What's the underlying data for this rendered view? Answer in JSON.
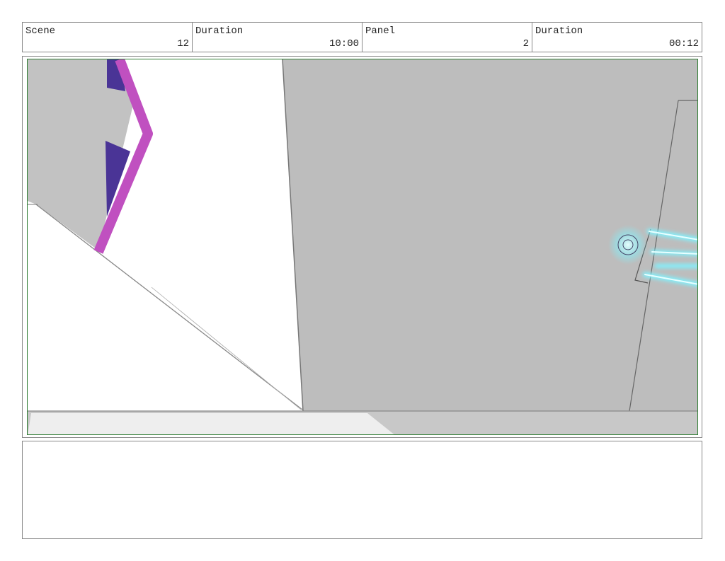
{
  "header": {
    "cells": [
      {
        "label": "Scene",
        "value": "12"
      },
      {
        "label": "Duration",
        "value": "10:00"
      },
      {
        "label": "Panel",
        "value": "2"
      },
      {
        "label": "Duration",
        "value": "00:12"
      }
    ]
  },
  "notes": {
    "text": ""
  },
  "colors": {
    "frame_border": "#2e7d32",
    "wall_gray": "#bdbdbd",
    "magenta": "#c050c0",
    "indigo": "#4a3496",
    "cyan_glow": "#7ff3ff"
  }
}
